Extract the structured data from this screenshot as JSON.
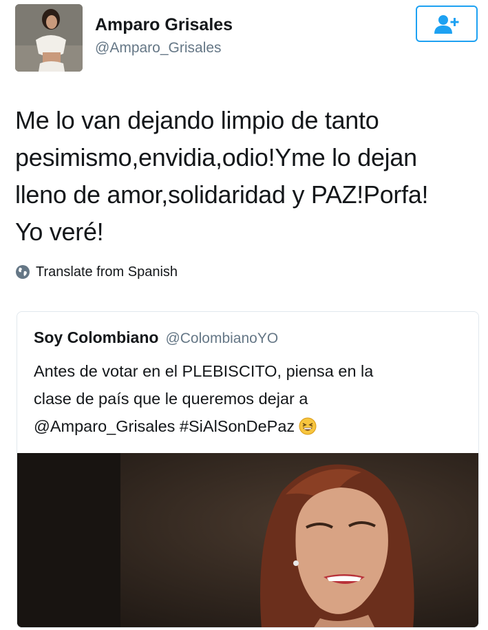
{
  "author": {
    "name": "Amparo Grisales",
    "handle": "@Amparo_Grisales",
    "avatar_icon": "profile-photo"
  },
  "follow_button": {
    "icon": "add-user-icon",
    "color": "#1da1f2"
  },
  "tweet": {
    "lines": [
      "Me lo van dejando limpio de tanto",
      "pesimismo,envidia,odio!Yme lo dejan",
      "lleno de amor,solidaridad y PAZ!Porfa!",
      "Yo veré!"
    ]
  },
  "translate": {
    "label": "Translate from Spanish",
    "icon": "globe-icon"
  },
  "quoted_tweet": {
    "name": "Soy Colombiano",
    "handle": "@ColombianoYO",
    "lines": [
      "Antes de votar en el PLEBISCITO, piensa en la",
      "clase de país que le queremos dejar a",
      "@Amparo_Grisales #SiAlSonDePaz"
    ],
    "emoji": "grinning-squinting-face-emoji",
    "media": "photo"
  },
  "colors": {
    "text": "#14171a",
    "secondary": "#657786",
    "accent": "#1da1f2",
    "border": "#e1e8ed"
  }
}
